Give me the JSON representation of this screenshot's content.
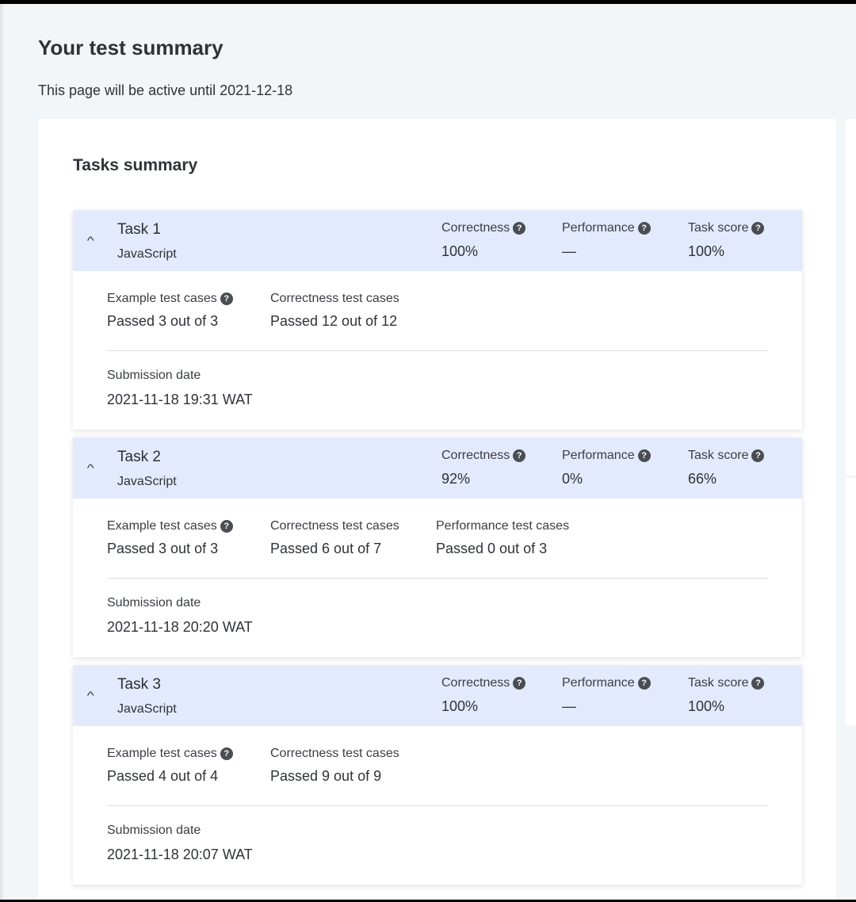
{
  "page": {
    "title": "Your test summary",
    "subtitle": "This page will be active until 2021-12-18"
  },
  "summary": {
    "title": "Tasks summary",
    "labels": {
      "correctness": "Correctness",
      "performance": "Performance",
      "task_score": "Task score",
      "example_cases": "Example test cases",
      "correctness_cases": "Correctness test cases",
      "performance_cases": "Performance test cases",
      "submission_date": "Submission date"
    },
    "tasks": [
      {
        "name": "Task 1",
        "language": "JavaScript",
        "correctness": "100%",
        "performance": "—",
        "task_score": "100%",
        "example_cases": "Passed 3 out of 3",
        "correctness_cases": "Passed 12 out of 12",
        "performance_cases": "",
        "submission_date": "2021-11-18 19:31 WAT"
      },
      {
        "name": "Task 2",
        "language": "JavaScript",
        "correctness": "92%",
        "performance": "0%",
        "task_score": "66%",
        "example_cases": "Passed 3 out of 3",
        "correctness_cases": "Passed 6 out of 7",
        "performance_cases": "Passed 0 out of 3",
        "submission_date": "2021-11-18 20:20 WAT"
      },
      {
        "name": "Task 3",
        "language": "JavaScript",
        "correctness": "100%",
        "performance": "—",
        "task_score": "100%",
        "example_cases": "Passed 4 out of 4",
        "correctness_cases": "Passed 9 out of 9",
        "performance_cases": "",
        "submission_date": "2021-11-18 20:07 WAT"
      }
    ]
  },
  "icons": {
    "help": "question-mark-circle-icon",
    "collapse": "chevron-up-icon"
  },
  "colors": {
    "task_header_bg": "#e3eafd",
    "page_bg": "#f3f6f8",
    "card_bg": "#ffffff"
  }
}
